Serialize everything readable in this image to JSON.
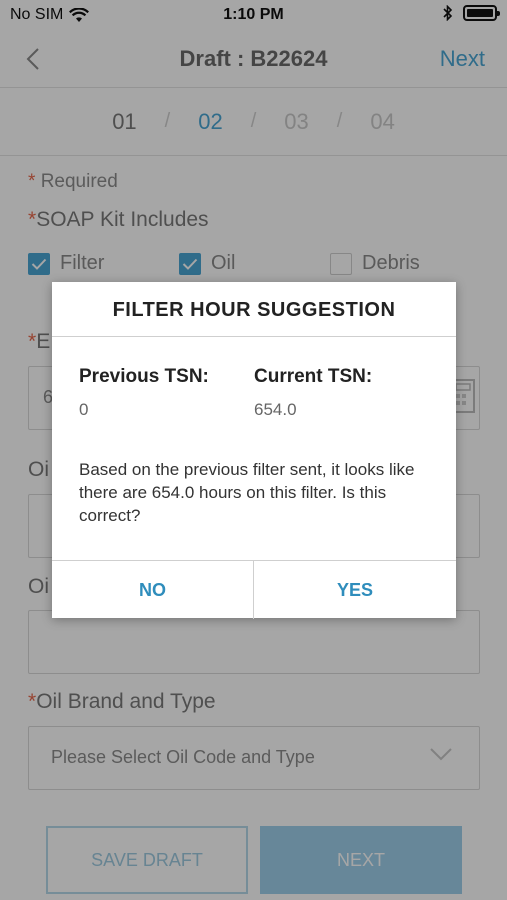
{
  "status_bar": {
    "carrier": "No SIM",
    "time": "1:10 PM"
  },
  "header": {
    "title": "Draft : B22624",
    "next_label": "Next"
  },
  "steps": [
    {
      "label": "01",
      "state": "done"
    },
    {
      "label": "02",
      "state": "active"
    },
    {
      "label": "03",
      "state": "future"
    },
    {
      "label": "04",
      "state": "future"
    }
  ],
  "step_separator": "/",
  "form": {
    "required_note": "Required",
    "required_marker": "*",
    "soap_label": "SOAP Kit Includes",
    "checkboxes": [
      {
        "label": "Filter",
        "checked": true
      },
      {
        "label": "Oil",
        "checked": true
      },
      {
        "label": "Debris",
        "checked": false
      }
    ],
    "partial_label_e": "E",
    "partial_value_6": "6",
    "partial_label_oi1": "Oi",
    "partial_label_oi2": "Oi",
    "oil_brand_label": "Oil Brand and Type",
    "oil_brand_placeholder": "Please Select Oil Code and Type"
  },
  "buttons": {
    "save_draft": "SAVE DRAFT",
    "next": "NEXT"
  },
  "dialog": {
    "title": "FILTER HOUR SUGGESTION",
    "previous_label": "Previous TSN:",
    "previous_value": "0",
    "current_label": "Current TSN:",
    "current_value": "654.0",
    "message": "Based on the previous filter sent, it looks like there are 654.0 hours on this filter.  Is this correct?",
    "no_label": "NO",
    "yes_label": "YES"
  },
  "colors": {
    "accent": "#4aa6d5",
    "required": "#e8694d",
    "dialog_action": "#2f8dbc"
  }
}
